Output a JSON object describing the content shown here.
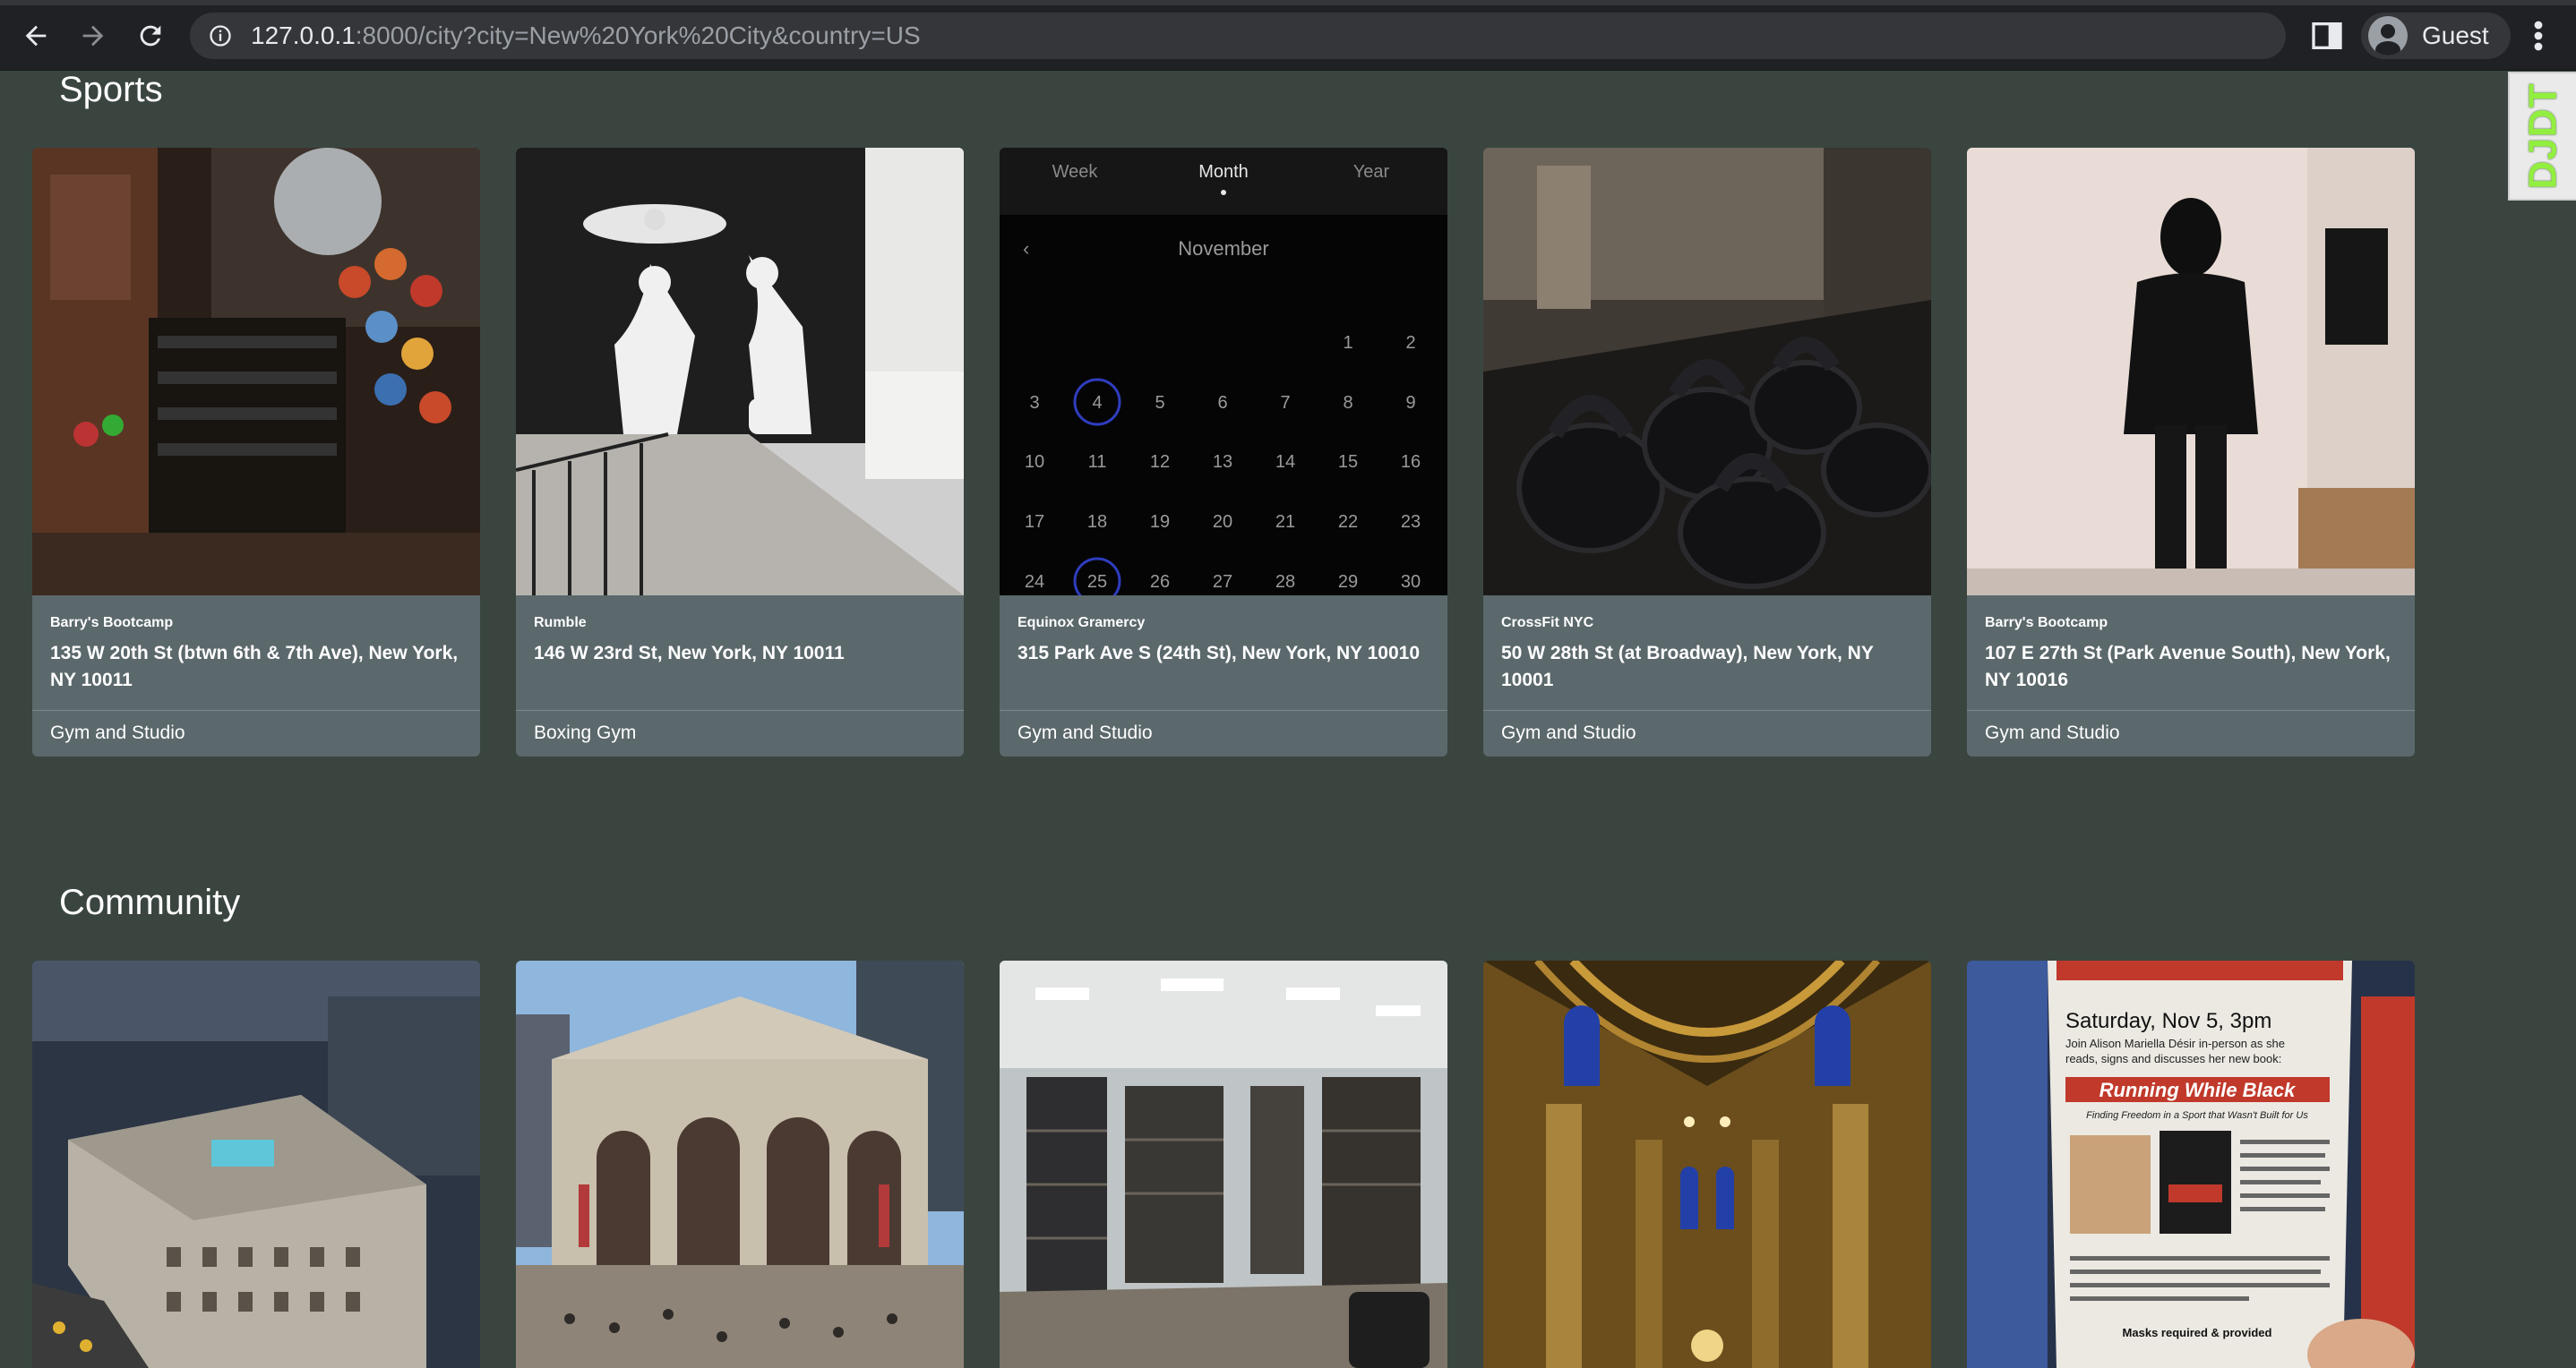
{
  "browser": {
    "url_host": "127.0.0.1",
    "url_path": ":8000/city?city=New%20York%20City&country=US",
    "profile_label": "Guest"
  },
  "debug_toolbar": {
    "label": "DJDT"
  },
  "sections": {
    "sports": {
      "title": "Sports",
      "cards": [
        {
          "name": "Barry's Bootcamp",
          "address": "135 W 20th St (btwn 6th & 7th Ave), New York, NY 10011",
          "category": "Gym and Studio"
        },
        {
          "name": "Rumble",
          "address": "146 W 23rd St, New York, NY 10011",
          "category": "Boxing Gym"
        },
        {
          "name": "Equinox Gramercy",
          "address": "315 Park Ave S (24th St), New York, NY 10010",
          "category": "Gym and Studio"
        },
        {
          "name": "CrossFit NYC",
          "address": "50 W 28th St (at Broadway), New York, NY 10001",
          "category": "Gym and Studio"
        },
        {
          "name": "Barry's Bootcamp",
          "address": "107 E 27th St (Park Avenue South), New York, NY 10016",
          "category": "Gym and Studio"
        }
      ]
    },
    "community": {
      "title": "Community"
    }
  },
  "calendar": {
    "tabs": [
      "Week",
      "Month",
      "Year"
    ],
    "month": "November",
    "row1": [
      "",
      "",
      "",
      "",
      "",
      "1",
      "2"
    ],
    "row2": [
      "3",
      "4",
      "5",
      "6",
      "7",
      "8",
      "9"
    ],
    "row3": [
      "10",
      "11",
      "12",
      "13",
      "14",
      "15",
      "16"
    ],
    "row4": [
      "17",
      "18",
      "19",
      "20",
      "21",
      "22",
      "23"
    ],
    "row5": [
      "24",
      "25",
      "26",
      "27",
      "28",
      "29",
      "30"
    ]
  },
  "flyer": {
    "header": "Saturday, Nov 5, 3pm",
    "line1": "Join Alison Mariella Désir in-person as she",
    "line2": "reads, signs and discusses her new book:",
    "book_title": "Running While Black",
    "book_subtitle": "Finding Freedom in a Sport that Wasn't Built for Us",
    "footer": "Masks required & provided"
  }
}
